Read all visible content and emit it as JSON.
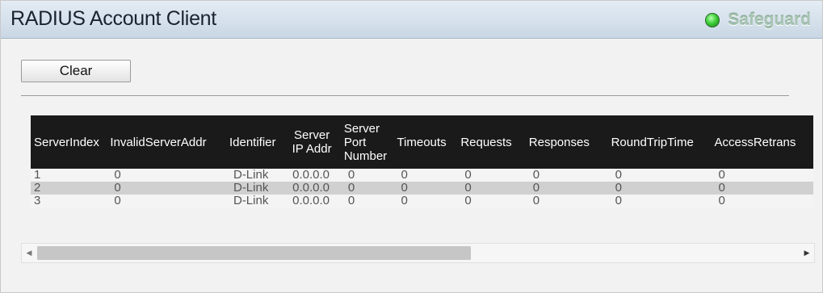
{
  "header": {
    "title": "RADIUS Account Client",
    "status_label": "Safeguard"
  },
  "toolbar": {
    "clear_label": "Clear"
  },
  "table": {
    "columns": [
      "ServerIndex",
      "InvalidServerAddr",
      "Identifier",
      "Server IP Addr",
      "Server Port Number",
      "Timeouts",
      "Requests",
      "Responses",
      "RoundTripTime",
      "AccessRetrans"
    ],
    "rows": [
      [
        "1",
        "0",
        "D-Link",
        "0.0.0.0",
        "0",
        "0",
        "0",
        "0",
        "0",
        "0"
      ],
      [
        "2",
        "0",
        "D-Link",
        "0.0.0.0",
        "0",
        "0",
        "0",
        "0",
        "0",
        "0"
      ],
      [
        "3",
        "0",
        "D-Link",
        "0.0.0.0",
        "0",
        "0",
        "0",
        "0",
        "0",
        "0"
      ]
    ]
  },
  "scrollbar": {
    "position_fraction": 0.0,
    "visible_fraction": 0.56
  },
  "colors": {
    "header_bg": "#c9d7e4",
    "table_header_bg": "#1a1a1a",
    "row_odd": "#f4f4f4",
    "row_even": "#d0d0d0",
    "status_led": "#3fcf3a"
  },
  "icons": {
    "status": "green-led-icon",
    "scroll_left": "arrow-left-icon",
    "scroll_right": "arrow-right-icon"
  }
}
